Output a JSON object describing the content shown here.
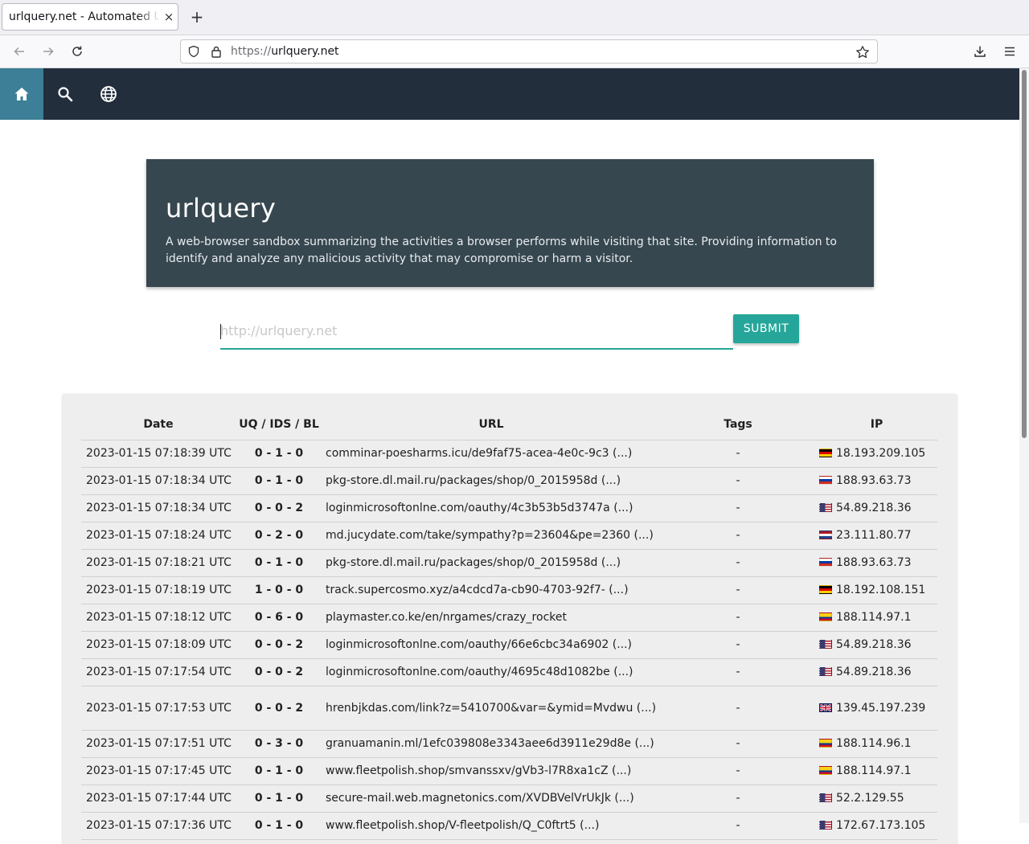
{
  "browser": {
    "tab_title": "urlquery.net - Automated URL Analysis",
    "tab_close": "×",
    "new_tab": "+",
    "url_scheme": "https://",
    "url_host": "urlquery.net"
  },
  "site": {
    "nav": [
      {
        "icon": "home-icon"
      },
      {
        "icon": "search-icon"
      },
      {
        "icon": "globe-icon"
      }
    ],
    "hero": {
      "title": "urlquery",
      "description": "A web-browser sandbox summarizing the activities a browser performs while visiting that site. Providing information to identify and analyze any malicious activity that may compromise or harm a visitor."
    },
    "search": {
      "placeholder": "http://urlquery.net",
      "value": "",
      "submit_label": "SUBMIT"
    },
    "table": {
      "headers": [
        "Date",
        "UQ / IDS / BL",
        "URL",
        "Tags",
        "IP"
      ],
      "rows": [
        {
          "date": "2023-01-15 07:18:39 UTC",
          "uq": "0 - 1 - 0",
          "url": "comminar-poesharms.icu/de9faf75-acea-4e0c-9c3 (...)",
          "tags": "-",
          "flag": "de",
          "ip": "18.193.209.105"
        },
        {
          "date": "2023-01-15 07:18:34 UTC",
          "uq": "0 - 1 - 0",
          "url": "pkg-store.dl.mail.ru/packages/shop/0_2015958d (...)",
          "tags": "-",
          "flag": "ru",
          "ip": "188.93.63.73"
        },
        {
          "date": "2023-01-15 07:18:34 UTC",
          "uq": "0 - 0 - 2",
          "url": "loginmicrosoftonlne.com/oauthy/4c3b53b5d3747a (...)",
          "tags": "-",
          "flag": "us",
          "ip": "54.89.218.36"
        },
        {
          "date": "2023-01-15 07:18:24 UTC",
          "uq": "0 - 2 - 0",
          "url": "md.jucydate.com/take/sympathy?p=23604&pe=2360 (...)",
          "tags": "-",
          "flag": "nl",
          "ip": "23.111.80.77"
        },
        {
          "date": "2023-01-15 07:18:21 UTC",
          "uq": "0 - 1 - 0",
          "url": "pkg-store.dl.mail.ru/packages/shop/0_2015958d (...)",
          "tags": "-",
          "flag": "ru",
          "ip": "188.93.63.73"
        },
        {
          "date": "2023-01-15 07:18:19 UTC",
          "uq": "1 - 0 - 0",
          "url": "track.supercosmo.xyz/a4cdcd7a-cb90-4703-92f7- (...)",
          "tags": "-",
          "flag": "de",
          "ip": "18.192.108.151"
        },
        {
          "date": "2023-01-15 07:18:12 UTC",
          "uq": "0 - 6 - 0",
          "url": "playmaster.co.ke/en/nrgames/crazy_rocket",
          "tags": "-",
          "flag": "co",
          "ip": "188.114.97.1"
        },
        {
          "date": "2023-01-15 07:18:09 UTC",
          "uq": "0 - 0 - 2",
          "url": "loginmicrosoftonlne.com/oauthy/66e6cbc34a6902 (...)",
          "tags": "-",
          "flag": "us",
          "ip": "54.89.218.36"
        },
        {
          "date": "2023-01-15 07:17:54 UTC",
          "uq": "0 - 0 - 2",
          "url": "loginmicrosoftonlne.com/oauthy/4695c48d1082be (...)",
          "tags": "-",
          "flag": "us",
          "ip": "54.89.218.36"
        },
        {
          "date": "2023-01-15 07:17:53 UTC",
          "uq": "0 - 0 - 2",
          "url": "hrenbjkdas.com/link?z=5410700&var=&ymid=Mvdwu (...)",
          "tags": "-",
          "flag": "gb",
          "ip": "139.45.197.239"
        },
        {
          "date": "2023-01-15 07:17:51 UTC",
          "uq": "0 - 3 - 0",
          "url": "granuamanin.ml/1efc039808e3343aee6d3911e29d8e (...)",
          "tags": "-",
          "flag": "co",
          "ip": "188.114.96.1"
        },
        {
          "date": "2023-01-15 07:17:45 UTC",
          "uq": "0 - 1 - 0",
          "url": "www.fleetpolish.shop/smvanssxv/gVb3-l7R8xa1cZ (...)",
          "tags": "-",
          "flag": "co",
          "ip": "188.114.97.1"
        },
        {
          "date": "2023-01-15 07:17:44 UTC",
          "uq": "0 - 1 - 0",
          "url": "secure-mail.web.magnetonics.com/XVDBVelVrUkJk (...)",
          "tags": "-",
          "flag": "us",
          "ip": "52.2.129.55"
        },
        {
          "date": "2023-01-15 07:17:36 UTC",
          "uq": "0 - 1 - 0",
          "url": "www.fleetpolish.shop/V-fleetpolish/Q_C0ftrt5 (...)",
          "tags": "-",
          "flag": "us",
          "ip": "172.67.173.105"
        }
      ]
    }
  },
  "colors": {
    "site_nav_bg": "#222e3c",
    "nav_active": "#3c7f97",
    "hero_bg": "#37474f",
    "accent": "#26a69a"
  }
}
